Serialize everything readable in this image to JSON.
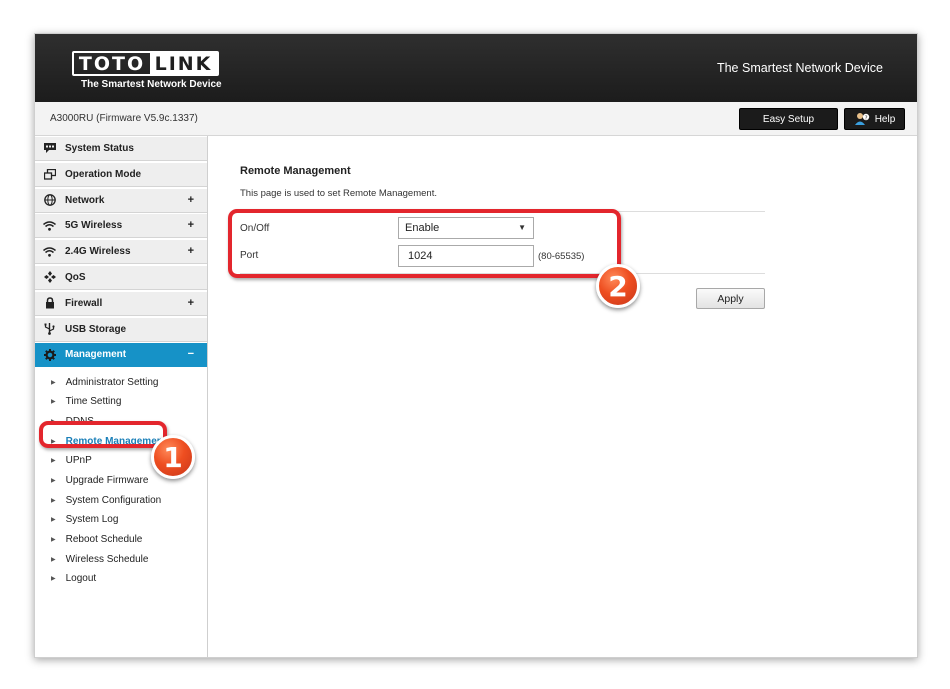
{
  "header": {
    "logo_left": "TOTO",
    "logo_right": "LINK",
    "logo_tagline": "The Smartest Network Device",
    "tagline": "The Smartest Network Device"
  },
  "subbar": {
    "firmware": "A3000RU (Firmware V5.9c.1337)",
    "easy_setup": "Easy Setup",
    "help": "Help"
  },
  "sidebar": {
    "items": [
      {
        "label": "System Status",
        "icon": "chat-bubble-icon",
        "expand": ""
      },
      {
        "label": "Operation Mode",
        "icon": "windows-icon",
        "expand": ""
      },
      {
        "label": "Network",
        "icon": "globe-icon",
        "expand": "+"
      },
      {
        "label": "5G Wireless",
        "icon": "wifi-icon",
        "expand": "+"
      },
      {
        "label": "2.4G Wireless",
        "icon": "wifi-icon",
        "expand": "+"
      },
      {
        "label": "QoS",
        "icon": "qos-icon",
        "expand": ""
      },
      {
        "label": "Firewall",
        "icon": "lock-icon",
        "expand": "+"
      },
      {
        "label": "USB Storage",
        "icon": "usb-icon",
        "expand": ""
      },
      {
        "label": "Management",
        "icon": "gear-icon",
        "expand": "−"
      }
    ],
    "submenu": [
      "Administrator Setting",
      "Time Setting",
      "DDNS",
      "Remote Management",
      "UPnP",
      "Upgrade Firmware",
      "System Configuration",
      "System Log",
      "Reboot Schedule",
      "Wireless Schedule",
      "Logout"
    ],
    "active_submenu": "Remote Management"
  },
  "content": {
    "title": "Remote Management",
    "description": "This page is used to set Remote Management.",
    "onoff_label": "On/Off",
    "onoff_value": "Enable",
    "port_label": "Port",
    "port_value": "1024",
    "port_range": "(80-65535)",
    "apply_label": "Apply"
  },
  "annotations": {
    "badge_1": "1",
    "badge_2": "2"
  },
  "colors": {
    "accent": "#1692c7",
    "header_bg": "#1c1c1c",
    "highlight": "#e3262d",
    "badge": "#ee4e20"
  }
}
